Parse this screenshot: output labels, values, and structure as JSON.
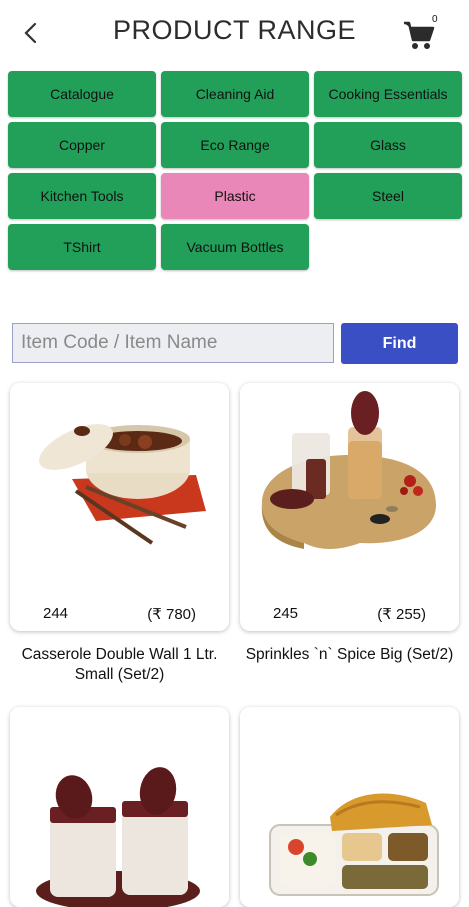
{
  "header": {
    "title": "PRODUCT RANGE",
    "cart_count": "0",
    "back_icon": "back-arrow-icon",
    "cart_icon": "cart-icon"
  },
  "categories": [
    {
      "label": "Catalogue",
      "selected": false
    },
    {
      "label": "Cleaning Aid",
      "selected": false
    },
    {
      "label": "Cooking Essentials",
      "selected": false
    },
    {
      "label": "Copper",
      "selected": false
    },
    {
      "label": "Eco Range",
      "selected": false
    },
    {
      "label": "Glass",
      "selected": false
    },
    {
      "label": "Kitchen Tools",
      "selected": false
    },
    {
      "label": "Plastic",
      "selected": true
    },
    {
      "label": "Steel",
      "selected": false
    },
    {
      "label": "TShirt",
      "selected": false
    },
    {
      "label": "Vacuum Bottles",
      "selected": false
    }
  ],
  "colors": {
    "category_bg": "#22a05a",
    "category_selected_bg": "#e987b9",
    "find_button_bg": "#3a4fc4"
  },
  "search": {
    "placeholder": "Item Code / Item Name",
    "value": "",
    "button_label": "Find"
  },
  "products": [
    {
      "code": "244",
      "price": "(₹ 780)",
      "name": "Casserole Double Wall 1 Ltr. Small (Set/2)"
    },
    {
      "code": "245",
      "price": "(₹ 255)",
      "name": "Sprinkles `n` Spice Big (Set/2)"
    },
    {
      "code": "",
      "price": "",
      "name": ""
    },
    {
      "code": "",
      "price": "",
      "name": ""
    }
  ]
}
